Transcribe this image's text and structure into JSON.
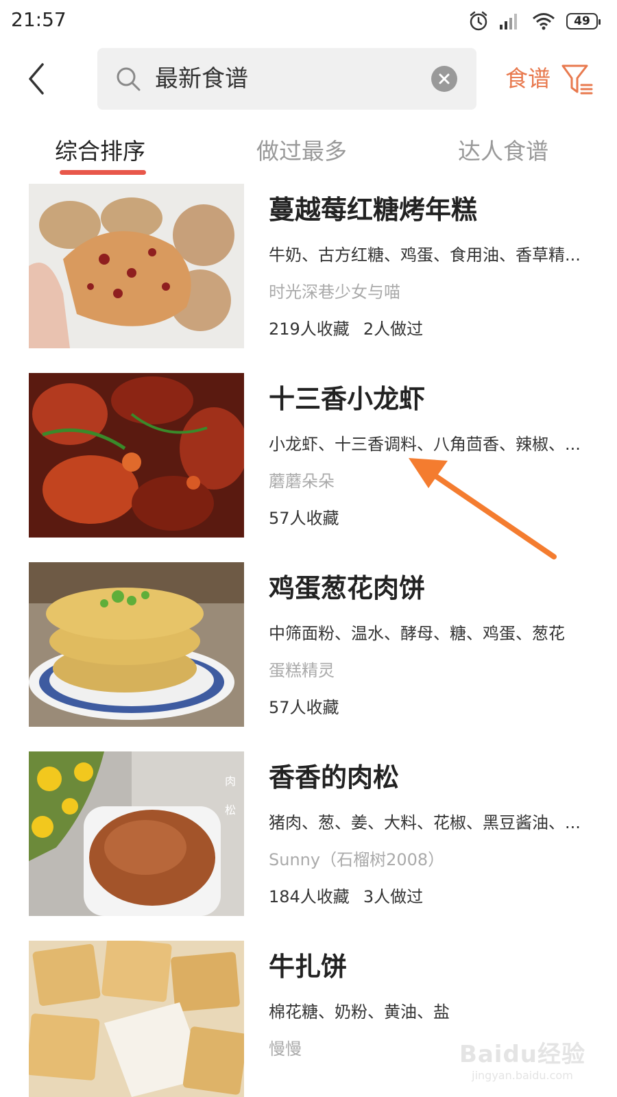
{
  "status_bar": {
    "time": "21:57",
    "battery": "49",
    "icons": [
      "alarm-icon",
      "signal-icon",
      "wifi-icon",
      "battery-icon"
    ]
  },
  "header": {
    "back_icon": "chevron-left-icon",
    "search_value": "最新食谱",
    "search_icon": "search-icon",
    "clear_icon": "clear-icon",
    "filter_label": "食谱",
    "filter_icon": "filter-icon"
  },
  "tabs": [
    {
      "label": "综合排序",
      "active": true
    },
    {
      "label": "做过最多",
      "active": false
    },
    {
      "label": "达人食谱",
      "active": false
    }
  ],
  "colors": {
    "accent": "#e8794e",
    "tab_indicator": "#e8574a",
    "arrow": "#f47c2f"
  },
  "recipes": [
    {
      "title": "蔓越莓红糖烤年糕",
      "ingredients": "牛奶、古方红糖、鸡蛋、食用油、香草精...",
      "author": "时光深巷少女与喵",
      "favorites": "219人收藏",
      "made": "2人做过"
    },
    {
      "title": "十三香小龙虾",
      "ingredients": "小龙虾、十三香调料、八角茴香、辣椒、...",
      "author": "蘑蘑朵朵",
      "favorites": "57人收藏",
      "made": ""
    },
    {
      "title": "鸡蛋葱花肉饼",
      "ingredients": "中筛面粉、温水、酵母、糖、鸡蛋、葱花",
      "author": "蛋糕精灵",
      "favorites": "57人收藏",
      "made": ""
    },
    {
      "title": "香香的肉松",
      "ingredients": "猪肉、葱、姜、大料、花椒、黑豆酱油、...",
      "author": "Sunny（石榴树2008）",
      "favorites": "184人收藏",
      "made": "3人做过",
      "thumb_text": [
        "肉",
        "松"
      ]
    },
    {
      "title": "牛扎饼",
      "ingredients": "棉花糖、奶粉、黄油、盐",
      "author": "慢慢",
      "favorites": "",
      "made": ""
    }
  ],
  "watermark": {
    "main": "Baidu经验",
    "sub": "jingyan.baidu.com"
  }
}
